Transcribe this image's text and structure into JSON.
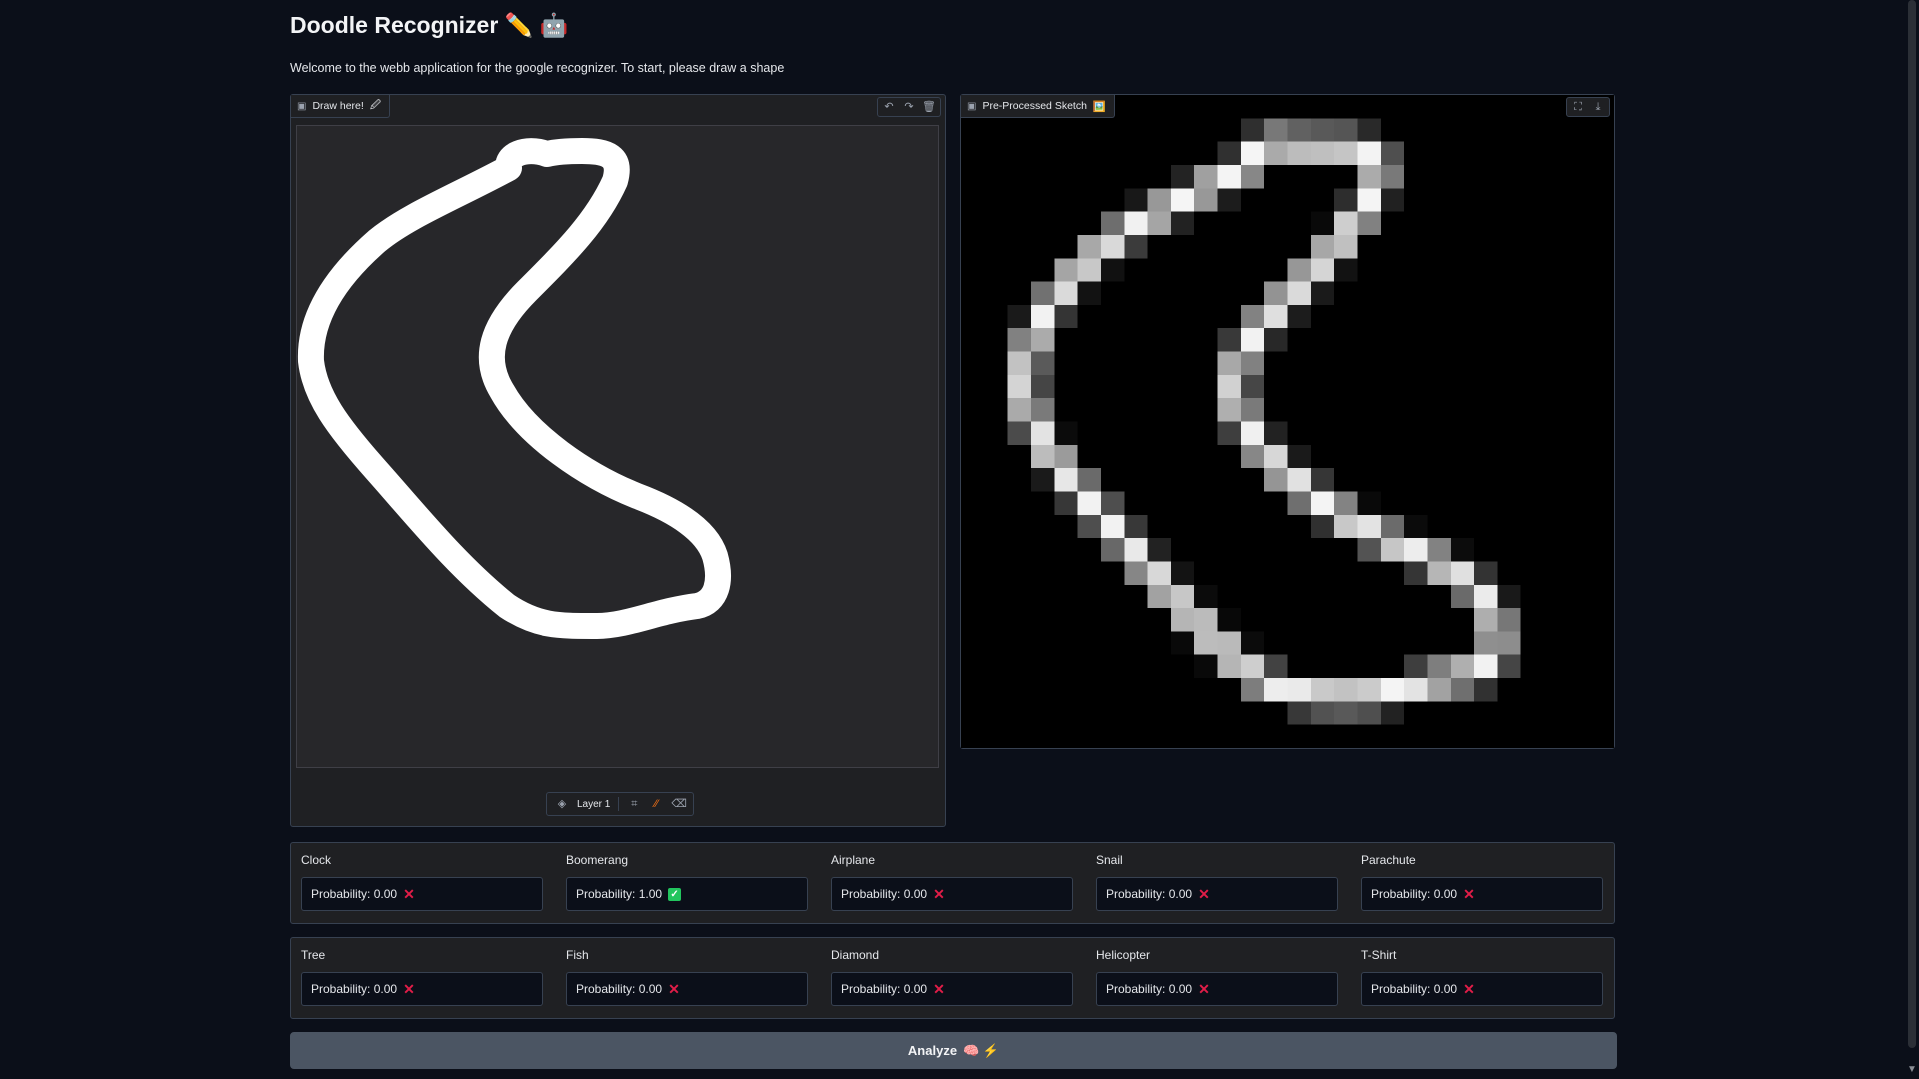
{
  "page": {
    "title": "Doodle Recognizer",
    "title_emoji": "✏️ 🤖",
    "intro": "Welcome to the webb application for the google recognizer. To start, please draw a shape"
  },
  "sketchpad": {
    "label": "Draw here!",
    "label_emoji": "🖉",
    "tools": [
      "undo-icon",
      "redo-icon",
      "trash-icon"
    ],
    "layer_label": "Layer 1",
    "bottom_tools": [
      "layers-icon",
      "crop-icon",
      "brush-icon",
      "eraser-icon"
    ],
    "stroke_color": "#ffffff",
    "background_color": "#27272a"
  },
  "preview": {
    "label": "Pre-Processed Sketch",
    "label_emoji": "🖼️",
    "tools": [
      "fullscreen-icon",
      "download-icon"
    ],
    "grid_size": 28
  },
  "results": {
    "row1": [
      {
        "name": "Clock",
        "value": "Probability: 0.00",
        "status": "x"
      },
      {
        "name": "Boomerang",
        "value": "Probability: 1.00",
        "status": "check"
      },
      {
        "name": "Airplane",
        "value": "Probability: 0.00",
        "status": "x"
      },
      {
        "name": "Snail",
        "value": "Probability: 0.00",
        "status": "x"
      },
      {
        "name": "Parachute",
        "value": "Probability: 0.00",
        "status": "x"
      }
    ],
    "row2": [
      {
        "name": "Tree",
        "value": "Probability: 0.00",
        "status": "x"
      },
      {
        "name": "Fish",
        "value": "Probability: 0.00",
        "status": "x"
      },
      {
        "name": "Diamond",
        "value": "Probability: 0.00",
        "status": "x"
      },
      {
        "name": "Helicopter",
        "value": "Probability: 0.00",
        "status": "x"
      },
      {
        "name": "T-Shirt",
        "value": "Probability: 0.00",
        "status": "x"
      }
    ]
  },
  "analyze_button": {
    "label": "Analyze",
    "emoji": "🧠 ⚡"
  },
  "colors": {
    "background": "#0b0f19",
    "panel": "#1f2023",
    "border": "#374151",
    "fail": "#e11d48",
    "success": "#22c55e",
    "button": "#4b5563"
  }
}
